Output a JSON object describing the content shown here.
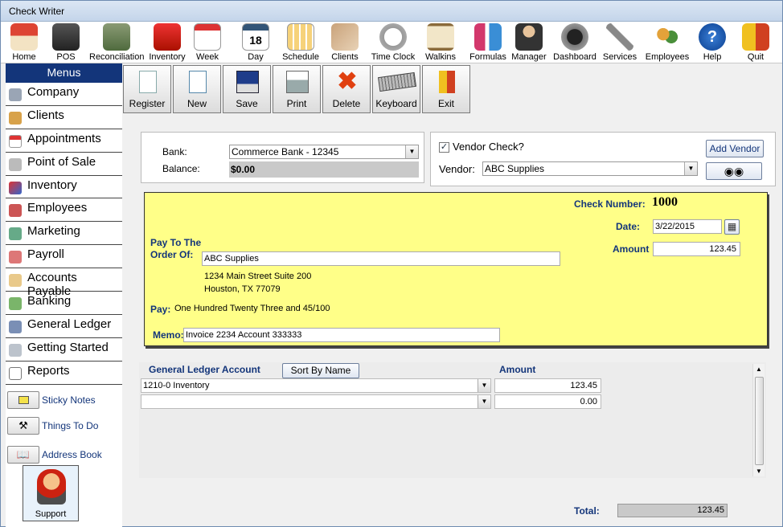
{
  "window": {
    "title": "Check Writer"
  },
  "topbar": {
    "items": [
      {
        "label": "Home",
        "icon": "house-icon"
      },
      {
        "label": "POS",
        "icon": "cash-register-icon"
      },
      {
        "label": "Reconciliation",
        "icon": "money-stack-icon"
      },
      {
        "label": "Inventory",
        "icon": "product-box-icon"
      },
      {
        "label": "Week",
        "icon": "week-calendar-icon"
      },
      {
        "label": "Day",
        "icon": "day-calendar-icon"
      },
      {
        "label": "Schedule",
        "icon": "schedule-grid-icon"
      },
      {
        "label": "Clients",
        "icon": "handshake-icon"
      },
      {
        "label": "Time Clock",
        "icon": "stopwatch-icon"
      },
      {
        "label": "Walkins",
        "icon": "hourglass-icon"
      },
      {
        "label": "Formulas",
        "icon": "test-tubes-icon"
      },
      {
        "label": "Manager",
        "icon": "manager-icon"
      },
      {
        "label": "Dashboard",
        "icon": "gauge-icon"
      },
      {
        "label": "Services",
        "icon": "scissors-icon"
      },
      {
        "label": "Employees",
        "icon": "people-icon"
      },
      {
        "label": "Help",
        "icon": "help-icon"
      },
      {
        "label": "Quit",
        "icon": "exit-door-icon"
      }
    ]
  },
  "sidebar": {
    "header": "Menus",
    "items": [
      {
        "label": "Company",
        "icon": "building-icon"
      },
      {
        "label": "Clients",
        "icon": "clients-icon"
      },
      {
        "label": "Appointments",
        "icon": "calendar-icon"
      },
      {
        "label": "Point of Sale",
        "icon": "cart-icon"
      },
      {
        "label": "Inventory",
        "icon": "boxes-icon"
      },
      {
        "label": "Employees",
        "icon": "employee-icon"
      },
      {
        "label": "Marketing",
        "icon": "marketing-icon"
      },
      {
        "label": "Payroll",
        "icon": "payroll-icon"
      },
      {
        "label": "Accounts Payable",
        "icon": "payable-icon"
      },
      {
        "label": "Banking",
        "icon": "banknote-icon"
      },
      {
        "label": "General Ledger",
        "icon": "ledger-icon"
      },
      {
        "label": "Getting Started",
        "icon": "keyboard-icon"
      },
      {
        "label": "Reports",
        "icon": "report-icon"
      }
    ],
    "utilities": [
      {
        "label": "Sticky Notes",
        "icon": "sticky-note-icon"
      },
      {
        "label": "Things To Do",
        "icon": "hammer-icon"
      },
      {
        "label": "Address Book",
        "icon": "address-book-icon"
      }
    ],
    "support": "Support"
  },
  "toolbar": {
    "buttons": [
      {
        "label": "Register",
        "icon": "register-icon"
      },
      {
        "label": "New",
        "icon": "new-document-icon"
      },
      {
        "label": "Save",
        "icon": "floppy-disk-icon"
      },
      {
        "label": "Print",
        "icon": "printer-icon"
      },
      {
        "label": "Delete",
        "icon": "delete-x-icon"
      },
      {
        "label": "Keyboard",
        "icon": "keyboard-icon"
      },
      {
        "label": "Exit",
        "icon": "exit-door-icon"
      }
    ]
  },
  "bank": {
    "bank_label": "Bank:",
    "bank_value": "Commerce Bank - 12345",
    "balance_label": "Balance:",
    "balance_value": "$0.00"
  },
  "vendor": {
    "check_label": "Vendor Check?",
    "checked": true,
    "vendor_label": "Vendor:",
    "vendor_value": "ABC Supplies",
    "add_vendor": "Add Vendor"
  },
  "check": {
    "number_label": "Check Number:",
    "number_value": "1000",
    "date_label": "Date:",
    "date_value": "3/22/2015",
    "amount_label": "Amount",
    "amount_value": "123.45",
    "payto_label_1": "Pay To The",
    "payto_label_2": "Order Of:",
    "payto_value": "ABC Supplies",
    "address_line1": "1234 Main Street Suite 200",
    "address_line2": "Houston, TX 77079",
    "pay_label": "Pay:",
    "pay_words": "One Hundred Twenty Three and 45/100",
    "memo_label": "Memo:",
    "memo_value": "Invoice 2234 Account 333333"
  },
  "gl": {
    "account_header": "General Ledger Account",
    "sort_button": "Sort By Name",
    "amount_header": "Amount",
    "rows": [
      {
        "account": "1210-0 Inventory",
        "amount": "123.45"
      },
      {
        "account": "",
        "amount": "0.00"
      }
    ],
    "total_label": "Total:",
    "total_value": "123.45"
  },
  "colors": {
    "check_bg": "#ffff88",
    "accent": "#13357a"
  }
}
